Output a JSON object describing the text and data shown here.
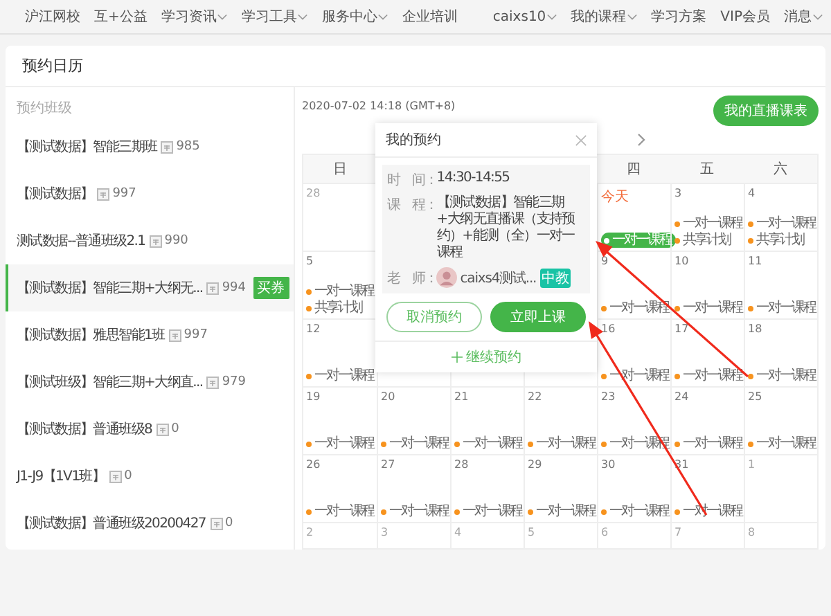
{
  "nav": {
    "left": [
      {
        "label": "沪江网校",
        "dropdown": false
      },
      {
        "label": "互+公益",
        "dropdown": false
      },
      {
        "label": "学习资讯",
        "dropdown": true
      },
      {
        "label": "学习工具",
        "dropdown": true
      },
      {
        "label": "服务中心",
        "dropdown": true
      },
      {
        "label": "企业培训",
        "dropdown": false
      }
    ],
    "right": [
      {
        "label": "caixs10",
        "dropdown": true
      },
      {
        "label": "我的课程",
        "dropdown": true
      },
      {
        "label": "学习方案",
        "dropdown": false
      },
      {
        "label": "VIP会员",
        "dropdown": false
      },
      {
        "label": "消息",
        "dropdown": true
      }
    ]
  },
  "page": {
    "title": "预约日历"
  },
  "classes": {
    "heading": "预约班级",
    "items": [
      {
        "name": "【测试数据】智能三期班",
        "count": "985",
        "selected": false
      },
      {
        "name": "【测试数据】",
        "count": "997",
        "selected": false
      },
      {
        "name": "测试数据--普通班级2.1",
        "count": "990",
        "selected": false
      },
      {
        "name": "【测试数据】智能三期+大纲无...",
        "count": "994",
        "selected": true,
        "action": "买券"
      },
      {
        "name": "【测试数据】雅思智能1班",
        "count": "997",
        "selected": false
      },
      {
        "name": "【测试班级】智能三期+大纲直...",
        "count": "979",
        "selected": false
      },
      {
        "name": "【测试数据】普通班级8",
        "count": "0",
        "selected": false
      },
      {
        "name": "J1-J9【1V1班】",
        "count": "0",
        "selected": false
      },
      {
        "name": "【测试数据】普通班级20200427",
        "count": "0",
        "selected": false
      }
    ]
  },
  "calendar": {
    "now": "2020-07-02 14:18 (GMT+8)",
    "schedule_button": "我的直播课表",
    "weekdays": [
      "日",
      "四",
      "五",
      "六"
    ],
    "weeks": [
      {
        "cells": [
          {
            "date": "28",
            "muted": true,
            "today": false
          },
          {
            "date": "今天",
            "muted": false,
            "today": true,
            "events": [
              {
                "label": "一对一课程",
                "selected": true
              }
            ]
          },
          {
            "date": "3",
            "muted": false,
            "today": false,
            "events": [
              {
                "label": "一对一课程",
                "selected": false
              },
              {
                "label": "共享计划",
                "selected": false
              }
            ]
          },
          {
            "date": "4",
            "muted": false,
            "today": false,
            "events": [
              {
                "label": "一对一课程",
                "selected": false
              },
              {
                "label": "共享计划",
                "selected": false
              }
            ]
          }
        ]
      },
      {
        "cells": [
          {
            "date": "5",
            "muted": false,
            "today": false,
            "events": [
              {
                "label": "一对一课程",
                "selected": false
              },
              {
                "label": "共享计划",
                "selected": false
              }
            ]
          },
          {
            "date": "9",
            "muted": false,
            "today": false,
            "events": [
              {
                "label": "一对一课程",
                "selected": false
              }
            ]
          },
          {
            "date": "10",
            "muted": false,
            "today": false,
            "events": [
              {
                "label": "一对一课程",
                "selected": false
              }
            ]
          },
          {
            "date": "11",
            "muted": false,
            "today": false,
            "events": [
              {
                "label": "一对一课程",
                "selected": false
              }
            ]
          }
        ]
      },
      {
        "cells": [
          {
            "date": "12",
            "muted": false,
            "today": false,
            "events": [
              {
                "label": "一对一课程",
                "selected": false
              }
            ]
          },
          {
            "date": "16",
            "muted": false,
            "today": false,
            "events": [
              {
                "label": "一对一课程",
                "selected": false
              }
            ]
          },
          {
            "date": "17",
            "muted": false,
            "today": false,
            "events": [
              {
                "label": "一对一课程",
                "selected": false
              }
            ]
          },
          {
            "date": "18",
            "muted": false,
            "today": false,
            "events": [
              {
                "label": "一对一课程",
                "selected": false
              }
            ]
          }
        ]
      },
      {
        "cells": [
          {
            "date": "19",
            "muted": false,
            "today": false,
            "events": [
              {
                "label": "一对一课程",
                "selected": false
              }
            ]
          },
          {
            "date": "20",
            "muted": false,
            "today": false,
            "events": [
              {
                "label": "一对一课程",
                "selected": false
              }
            ]
          },
          {
            "date": "21",
            "muted": false,
            "today": false,
            "events": [
              {
                "label": "一对一课程",
                "selected": false
              }
            ]
          },
          {
            "date": "22",
            "muted": false,
            "today": false,
            "events": [
              {
                "label": "一对一课程",
                "selected": false
              }
            ]
          },
          {
            "date": "23",
            "muted": false,
            "today": false,
            "events": [
              {
                "label": "一对一课程",
                "selected": false
              }
            ]
          },
          {
            "date": "24",
            "muted": false,
            "today": false,
            "events": [
              {
                "label": "一对一课程",
                "selected": false
              }
            ]
          },
          {
            "date": "25",
            "muted": false,
            "today": false,
            "events": [
              {
                "label": "一对一课程",
                "selected": false
              }
            ]
          }
        ]
      },
      {
        "cells": [
          {
            "date": "26",
            "muted": false,
            "today": false,
            "events": [
              {
                "label": "一对一课程",
                "selected": false
              }
            ]
          },
          {
            "date": "27",
            "muted": false,
            "today": false,
            "events": [
              {
                "label": "一对一课程",
                "selected": false
              }
            ]
          },
          {
            "date": "28",
            "muted": false,
            "today": false,
            "events": [
              {
                "label": "一对一课程",
                "selected": false
              }
            ]
          },
          {
            "date": "29",
            "muted": false,
            "today": false,
            "events": [
              {
                "label": "一对一课程",
                "selected": false
              }
            ]
          },
          {
            "date": "30",
            "muted": false,
            "today": false,
            "events": [
              {
                "label": "一对一课程",
                "selected": false
              }
            ]
          },
          {
            "date": "31",
            "muted": false,
            "today": false,
            "events": [
              {
                "label": "一对一课程",
                "selected": false
              }
            ]
          },
          {
            "date": "1",
            "muted": true,
            "today": false
          }
        ]
      },
      {
        "cells": [
          {
            "date": "2",
            "muted": true,
            "today": false
          },
          {
            "date": "3",
            "muted": true,
            "today": false
          },
          {
            "date": "4",
            "muted": true,
            "today": false
          },
          {
            "date": "5",
            "muted": true,
            "today": false
          },
          {
            "date": "6",
            "muted": true,
            "today": false
          },
          {
            "date": "7",
            "muted": true,
            "today": false
          },
          {
            "date": "8",
            "muted": true,
            "today": false
          }
        ]
      }
    ]
  },
  "popup": {
    "title": "我的预约",
    "rows": [
      {
        "label": "时　间：",
        "value": "14:30-14:55"
      },
      {
        "label": "课　程：",
        "value": "【测试数据】智能三期+大纲无直播课（支持预约）+能测（全）一对一课程"
      }
    ],
    "teacher": {
      "label": "老　师：",
      "name": "caixs4测试...",
      "badge": "中教"
    },
    "buttons": [
      {
        "label": "取消预约",
        "kind": "outline"
      },
      {
        "label": "立即上课",
        "kind": "primary"
      }
    ],
    "footer": "继续预约"
  }
}
